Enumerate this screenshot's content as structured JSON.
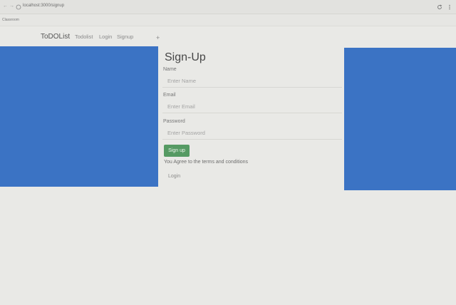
{
  "browser": {
    "back_glyph": "←",
    "forward_glyph": "→",
    "url": "localhost:3000/signup",
    "reload_icon": "reload-icon",
    "menu_icon": "menu-icon"
  },
  "bookmarks": {
    "label": "Classroom"
  },
  "nav": {
    "brand": "ToDOList",
    "links": [
      "Todolist",
      "Login",
      "Signup"
    ],
    "toggle_glyph": "+"
  },
  "form": {
    "title": "Sign-Up",
    "name": {
      "label": "Name",
      "placeholder": "Enter Name",
      "value": ""
    },
    "email": {
      "label": "Email",
      "placeholder": "Enter Email",
      "value": ""
    },
    "password": {
      "label": "Password",
      "placeholder": "Enter Password",
      "value": ""
    },
    "submit_label": "Sign up",
    "terms": "You Agree to the terms and conditions",
    "login_label": "Login"
  },
  "colors": {
    "side_panel": "#3b73c4",
    "submit_button": "#559a63",
    "page_background": "#e9e9e6"
  }
}
